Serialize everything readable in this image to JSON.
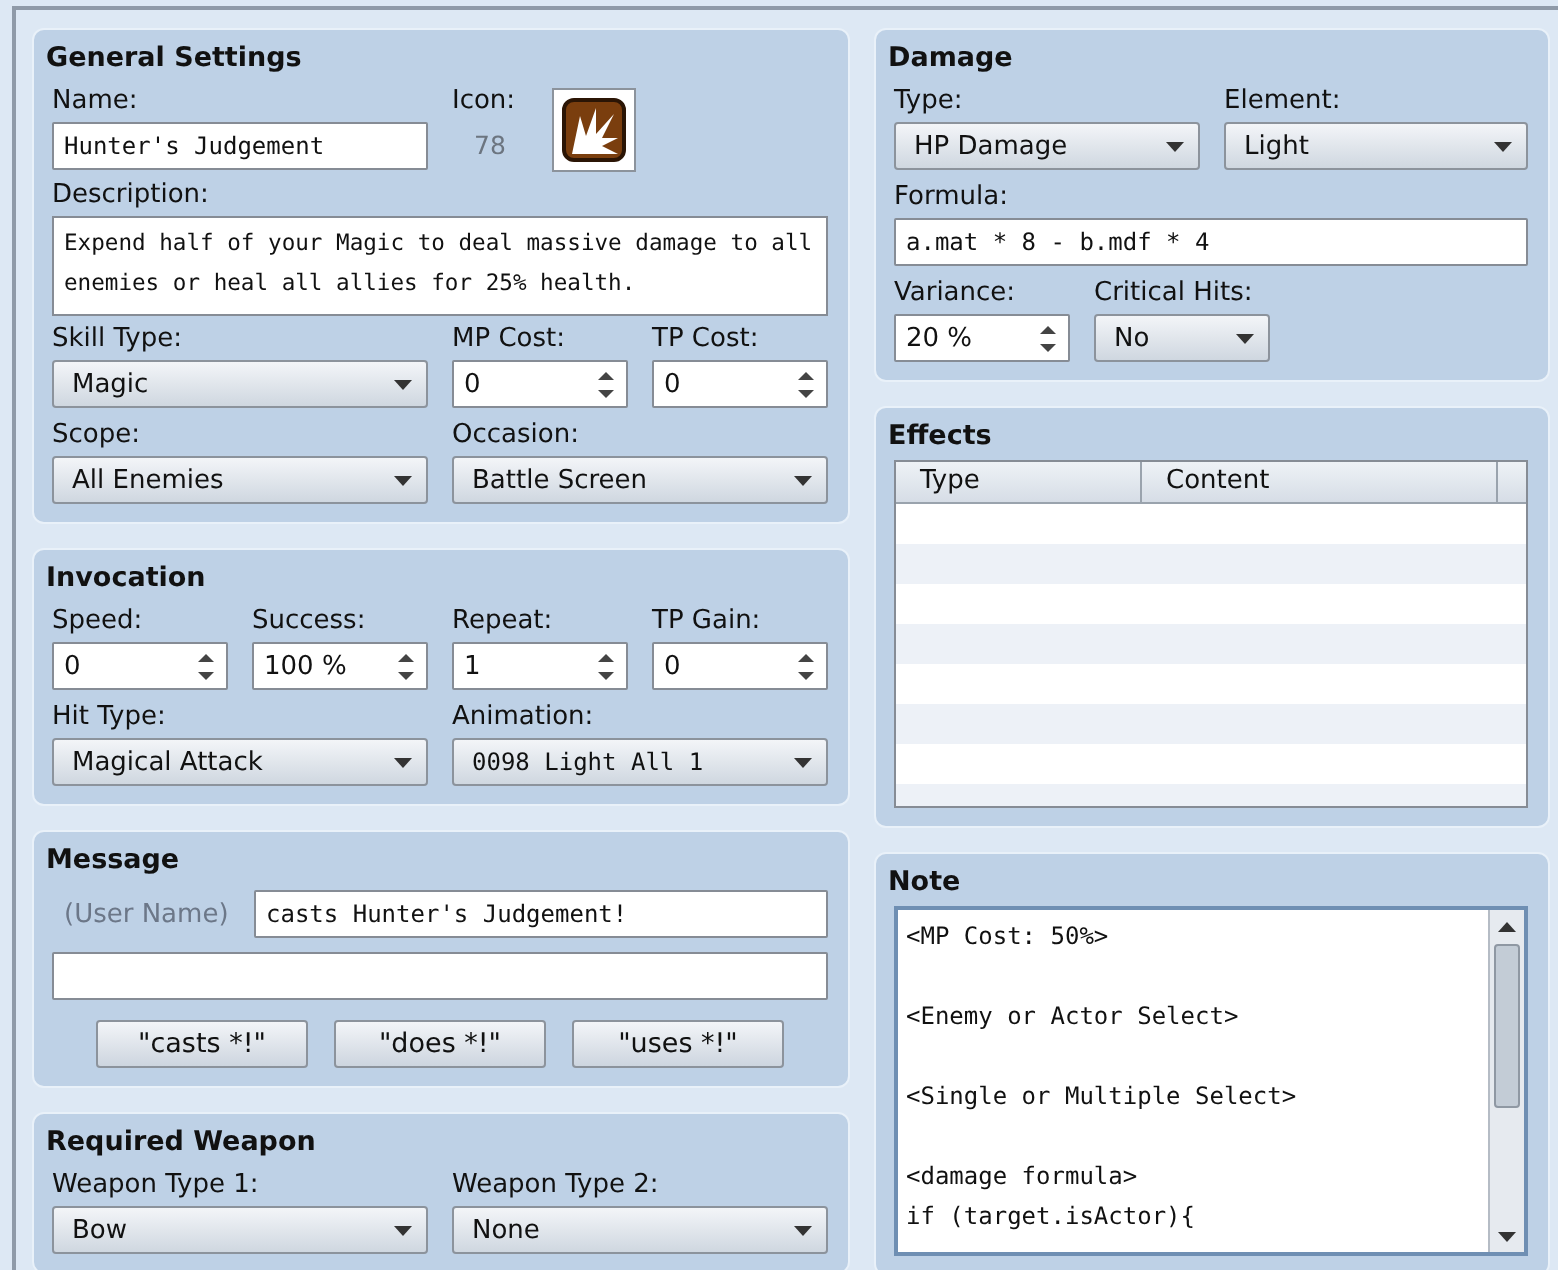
{
  "general_settings": {
    "title": "General Settings",
    "name": {
      "label": "Name:",
      "value": "Hunter's Judgement"
    },
    "icon": {
      "label": "Icon:",
      "index": "78"
    },
    "description": {
      "label": "Description:",
      "value": "Expend half of your Magic to deal massive damage to all enemies or heal all allies for 25% health."
    },
    "fields": [
      {
        "kind": "select",
        "label": "Skill Type:",
        "value": "Magic"
      },
      {
        "kind": "spin",
        "label": "MP Cost:",
        "value": "0"
      },
      {
        "kind": "spin",
        "label": "TP Cost:",
        "value": "0"
      },
      {
        "kind": "select",
        "label": "Scope:",
        "value": "All Enemies"
      },
      {
        "kind": "select",
        "label": "Occasion:",
        "value": "Battle Screen"
      }
    ]
  },
  "invocation": {
    "title": "Invocation",
    "fields": [
      {
        "kind": "spin",
        "label": "Speed:",
        "value": "0"
      },
      {
        "kind": "spin",
        "label": "Success:",
        "value": "100 %"
      },
      {
        "kind": "spin",
        "label": "Repeat:",
        "value": "1"
      },
      {
        "kind": "spin",
        "label": "TP Gain:",
        "value": "0"
      },
      {
        "kind": "select",
        "label": "Hit Type:",
        "value": "Magical Attack"
      },
      {
        "kind": "dataselect",
        "label": "Animation:",
        "value": "0098 Light All 1"
      }
    ]
  },
  "message": {
    "title": "Message",
    "user_name": "(User Name)",
    "line_1": "casts Hunter's Judgement!",
    "buttons": [
      "\"casts *!\"",
      "\"does *!\"",
      "\"uses *!\""
    ]
  },
  "required_weapon": {
    "title": "Required Weapon",
    "fields": [
      {
        "kind": "select",
        "label": "Weapon Type 1:",
        "value": "Bow"
      },
      {
        "kind": "select",
        "label": "Weapon Type 2:",
        "value": "None"
      }
    ]
  },
  "damage": {
    "title": "Damage",
    "fields": [
      {
        "kind": "select",
        "label": "Type:",
        "value": "HP Damage"
      },
      {
        "kind": "select",
        "label": "Element:",
        "value": "Light"
      },
      {
        "kind": "text",
        "label": "Formula:",
        "value": "a.mat * 8 - b.mdf * 4"
      },
      {
        "kind": "spin",
        "label": "Variance:",
        "value": "20 %"
      },
      {
        "kind": "select",
        "label": "Critical Hits:",
        "value": "No"
      }
    ]
  },
  "effects": {
    "title": "Effects",
    "columns": [
      "Type",
      "Content"
    ]
  },
  "note": {
    "title": "Note",
    "value": "<MP Cost: 50%>\n\n<Enemy or Actor Select>\n\n<Single or Multiple Select>\n\n<damage formula>\nif (target.isActor){"
  }
}
